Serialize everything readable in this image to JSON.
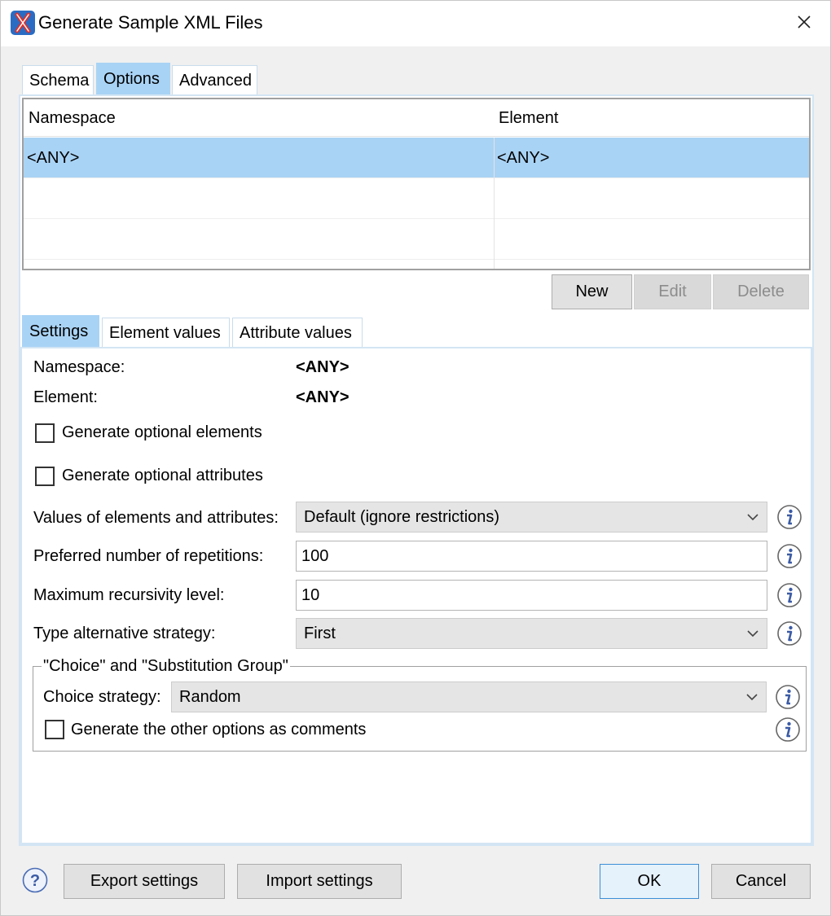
{
  "window": {
    "title": "Generate Sample XML Files",
    "app_icon": "oxygen-xml-icon",
    "close_icon": "close-icon"
  },
  "main_tabs": [
    {
      "label": "Schema",
      "active": false
    },
    {
      "label": "Options",
      "active": true
    },
    {
      "label": "Advanced",
      "active": false
    }
  ],
  "table": {
    "columns": [
      "Namespace",
      "Element"
    ],
    "rows": [
      [
        "<ANY>",
        "<ANY>"
      ]
    ],
    "selected_row": 0
  },
  "table_buttons": {
    "new": "New",
    "edit": "Edit",
    "delete": "Delete"
  },
  "sub_tabs": [
    {
      "label": "Settings",
      "active": true
    },
    {
      "label": "Element values",
      "active": false
    },
    {
      "label": "Attribute values",
      "active": false
    }
  ],
  "settings": {
    "namespace_label": "Namespace:",
    "namespace_value": "<ANY>",
    "element_label": "Element:",
    "element_value": "<ANY>",
    "gen_optional_elements": {
      "label": "Generate optional elements",
      "checked": false
    },
    "gen_optional_attributes": {
      "label": "Generate optional attributes",
      "checked": false
    },
    "values_label": "Values of elements and attributes:",
    "values_value": "Default (ignore restrictions)",
    "repetitions_label": "Preferred number of repetitions:",
    "repetitions_value": "100",
    "recursivity_label": "Maximum recursivity level:",
    "recursivity_value": "10",
    "type_alt_label": "Type alternative strategy:",
    "type_alt_value": "First",
    "choice_group": {
      "title": "\"Choice\" and \"Substitution Group\"",
      "choice_label": "Choice strategy:",
      "choice_value": "Random",
      "gen_other_options": {
        "label": "Generate the other options as comments",
        "checked": false
      }
    }
  },
  "footer": {
    "help_icon": "help-icon",
    "export": "Export settings",
    "import": "Import settings",
    "ok": "OK",
    "cancel": "Cancel"
  },
  "colors": {
    "selection": "#a9d3f5",
    "accent_border": "#3b8ed8",
    "info_icon": "#3b5ba5"
  }
}
